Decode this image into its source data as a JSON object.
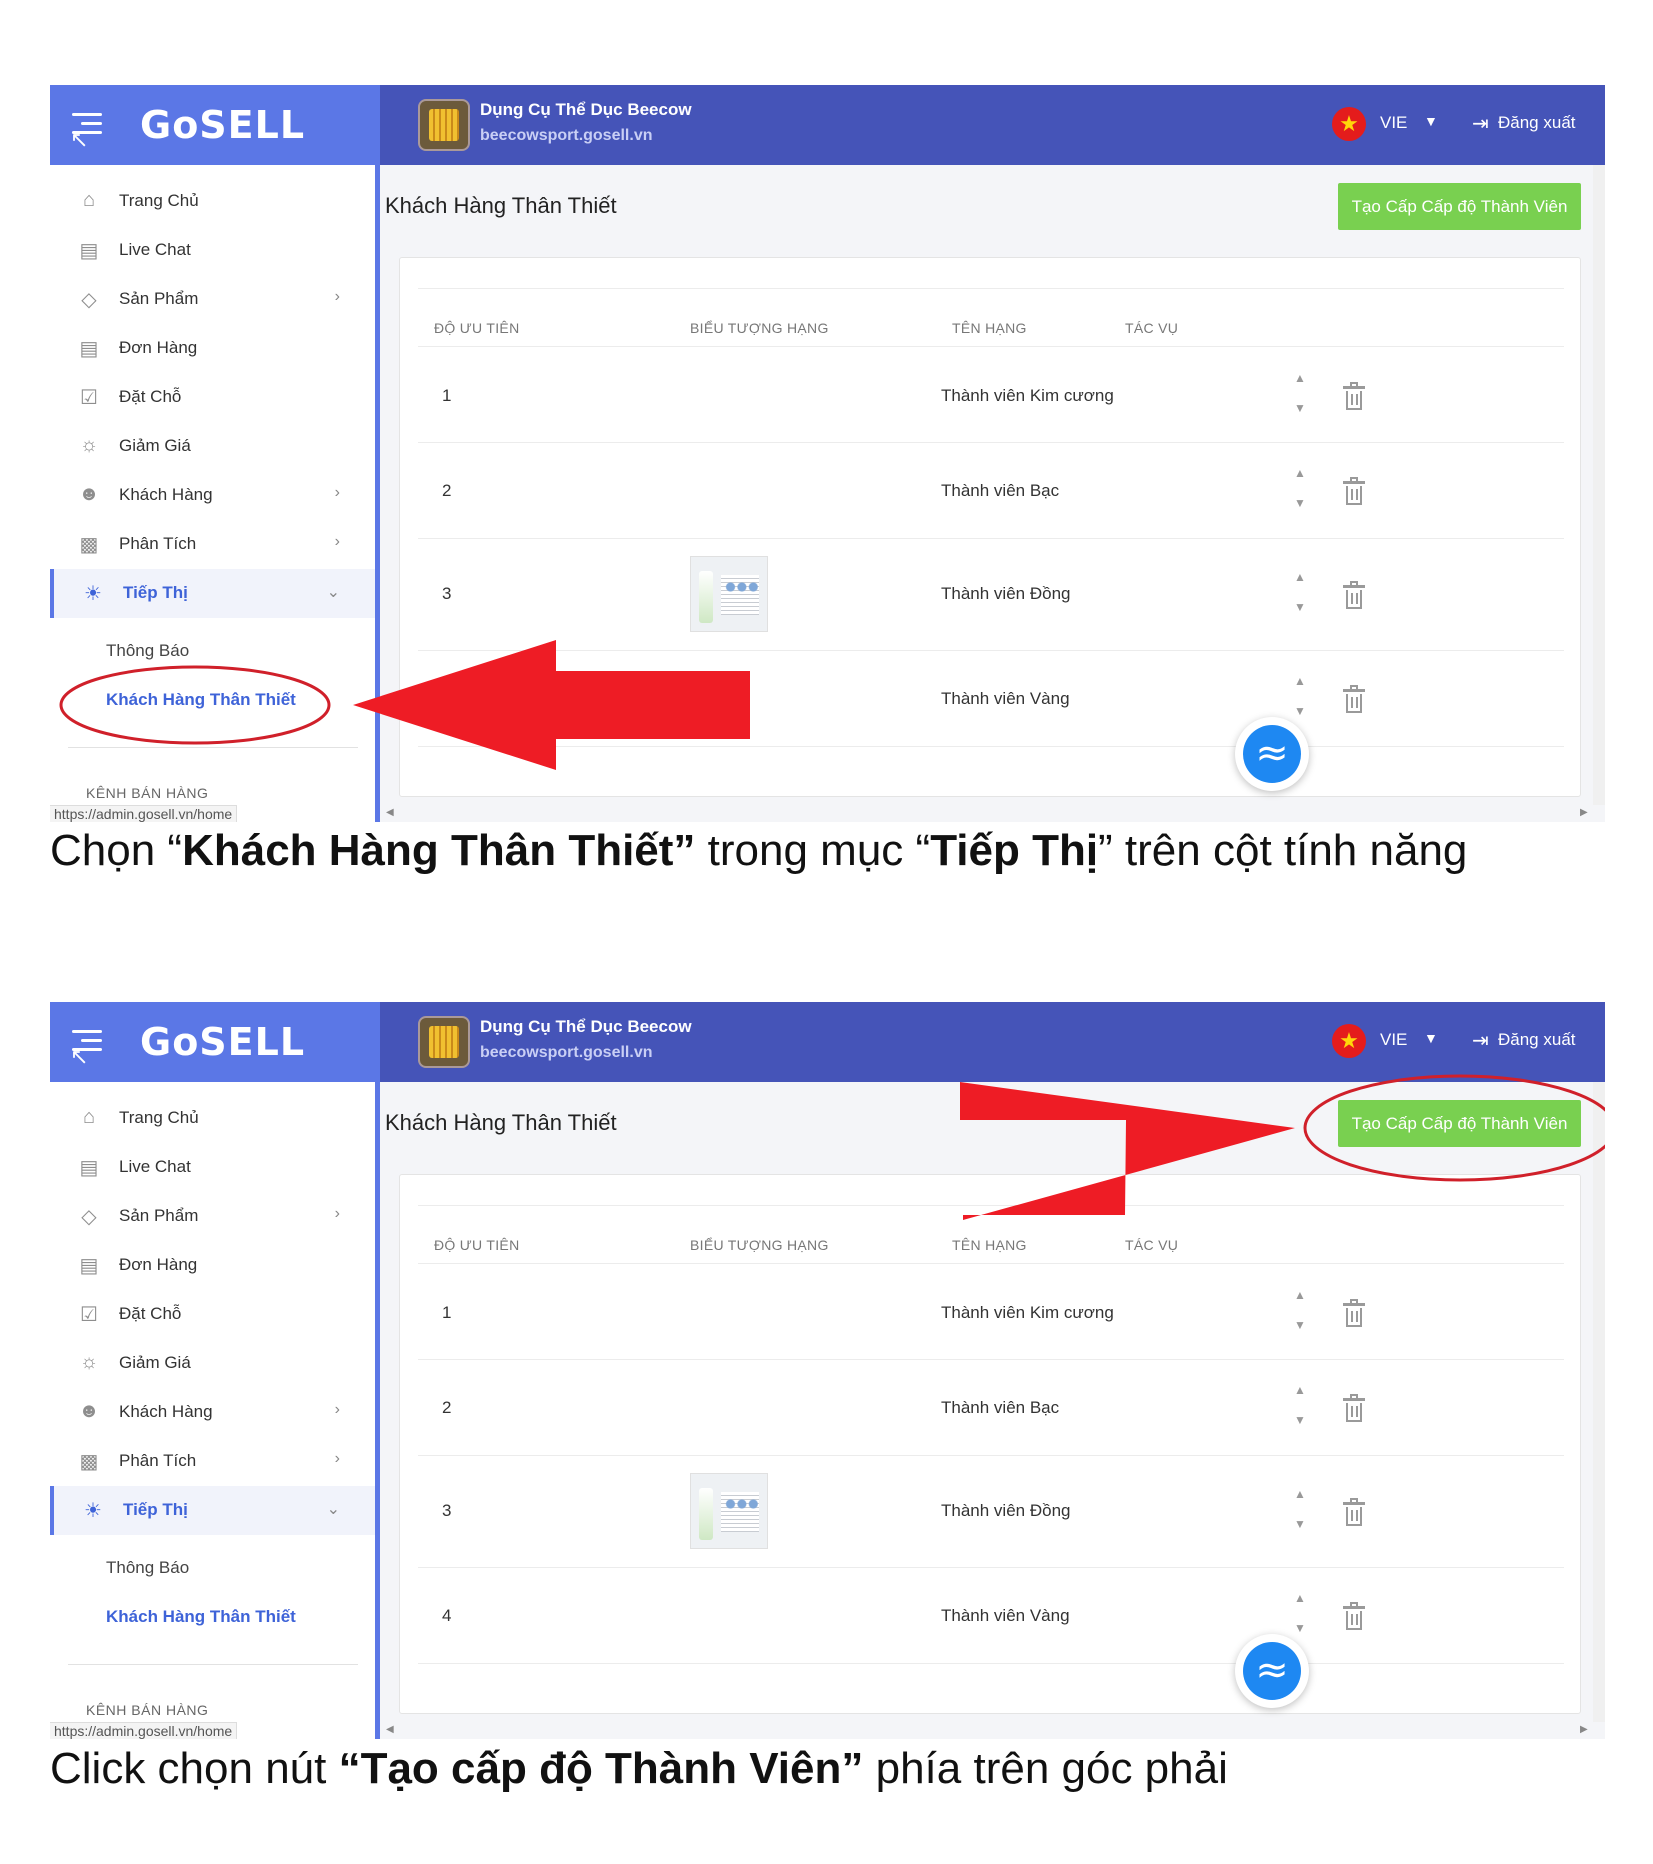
{
  "app": {
    "brand": "GoSELL",
    "store_name": "Dụng Cụ Thể Dục Beecow",
    "store_url": "beecowsport.gosell.vn",
    "language": "VIE",
    "logout": "Đăng xuất",
    "accent_color": "#5b77e6",
    "header_color": "#4554b8",
    "button_color": "#79d050"
  },
  "sidebar": {
    "items": [
      {
        "label": "Trang Chủ",
        "icon": "home-icon"
      },
      {
        "label": "Live Chat",
        "icon": "chat-icon"
      },
      {
        "label": "Sản Phẩm",
        "icon": "tag-icon"
      },
      {
        "label": "Đơn Hàng",
        "icon": "document-icon"
      },
      {
        "label": "Đặt Chỗ",
        "icon": "calendar-icon"
      },
      {
        "label": "Giảm Giá",
        "icon": "discount-icon"
      },
      {
        "label": "Khách Hàng",
        "icon": "users-icon"
      },
      {
        "label": "Phân Tích",
        "icon": "chart-icon"
      },
      {
        "label": "Tiếp Thị",
        "icon": "lightbulb-icon"
      }
    ],
    "sub_items": [
      "Thông Báo",
      "Khách Hàng Thân Thiết"
    ],
    "channel_label": "KÊNH BÁN HÀNG",
    "status_url": "https://admin.gosell.vn/home"
  },
  "main": {
    "page_title": "Khách Hàng Thân Thiết",
    "create_button": "Tạo Cấp Cấp độ Thành Viên",
    "table": {
      "headers": [
        "ĐỘ ƯU TIÊN",
        "BIỂU TƯỢNG HẠNG",
        "TÊN HẠNG",
        "TÁC VỤ"
      ],
      "rows": [
        {
          "priority": "1",
          "name": "Thành viên Kim cương"
        },
        {
          "priority": "2",
          "name": "Thành viên Bạc"
        },
        {
          "priority": "3",
          "name": "Thành viên Đồng"
        },
        {
          "priority": "4",
          "name": "Thành viên Vàng"
        }
      ]
    }
  },
  "annotations": {
    "arrow_color": "#ee1c25",
    "circle_color": "#d0202a"
  },
  "captions": {
    "step1": {
      "a": "Chọn “",
      "b": "Khách Hàng Thân Thiết”",
      "c": " trong mục “",
      "d": "Tiếp Thị",
      "e": "” trên cột tính năng"
    },
    "step2": {
      "a": "Click chọn nút ",
      "b": "“Tạo cấp độ Thành Viên”",
      "c": " phía trên góc phải"
    }
  }
}
